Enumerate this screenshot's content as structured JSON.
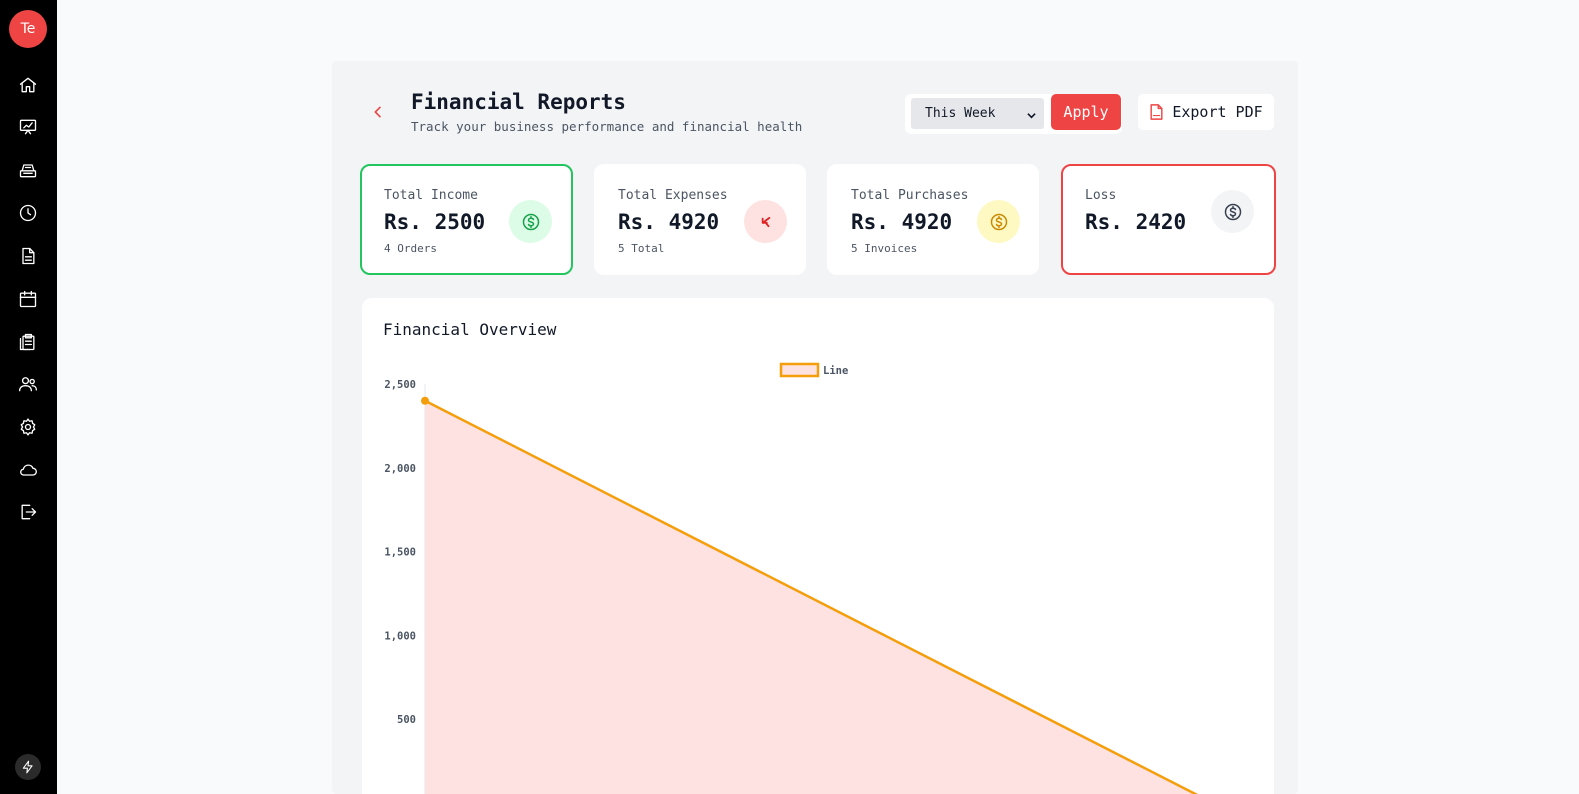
{
  "sidebar": {
    "avatar_initials": "Te",
    "items": [
      {
        "icon": "home-icon"
      },
      {
        "icon": "presentation-chart-icon"
      },
      {
        "icon": "cash-register-icon"
      },
      {
        "icon": "clock-icon"
      },
      {
        "icon": "document-icon"
      },
      {
        "icon": "calendar-icon"
      },
      {
        "icon": "clipboard-icon"
      },
      {
        "icon": "users-icon"
      },
      {
        "icon": "gear-icon"
      },
      {
        "icon": "cloud-icon"
      },
      {
        "icon": "logout-icon"
      }
    ],
    "footer_icon": "bolt-icon"
  },
  "header": {
    "title": "Financial Reports",
    "subtitle": "Track your business performance and financial health",
    "period_select": {
      "selected": "This Week"
    },
    "apply_label": "Apply",
    "export_label": "Export PDF"
  },
  "stats": [
    {
      "label": "Total Income",
      "value": "Rs. 2500",
      "sub": "4 Orders",
      "icon": "dollar-circle-icon",
      "accent": "#22c55e"
    },
    {
      "label": "Total Expenses",
      "value": "Rs. 4920",
      "sub": "5 Total",
      "icon": "expense-arrow-icon",
      "accent": "#ef4444"
    },
    {
      "label": "Total Purchases",
      "value": "Rs. 4920",
      "sub": "5 Invoices",
      "icon": "dollar-circle-icon",
      "accent": "#ca8a04"
    },
    {
      "label": "Loss",
      "value": "Rs. 2420",
      "sub": "",
      "icon": "dollar-circle-icon",
      "accent": "#374151"
    }
  ],
  "chart_card": {
    "title": "Financial Overview"
  },
  "colors": {
    "brand": "#ef4444",
    "income": "#22c55e",
    "line": "#f59e0b",
    "area_fill": "#fee2e2"
  },
  "chart_data": {
    "type": "area",
    "series": [
      {
        "name": "Line",
        "values": [
          2400,
          0
        ]
      }
    ],
    "y_ticks": [
      "2,500",
      "2,000",
      "1,500",
      "1,000",
      "500"
    ],
    "ylim": [
      0,
      2500
    ],
    "grid": false,
    "legend": "top-center"
  }
}
